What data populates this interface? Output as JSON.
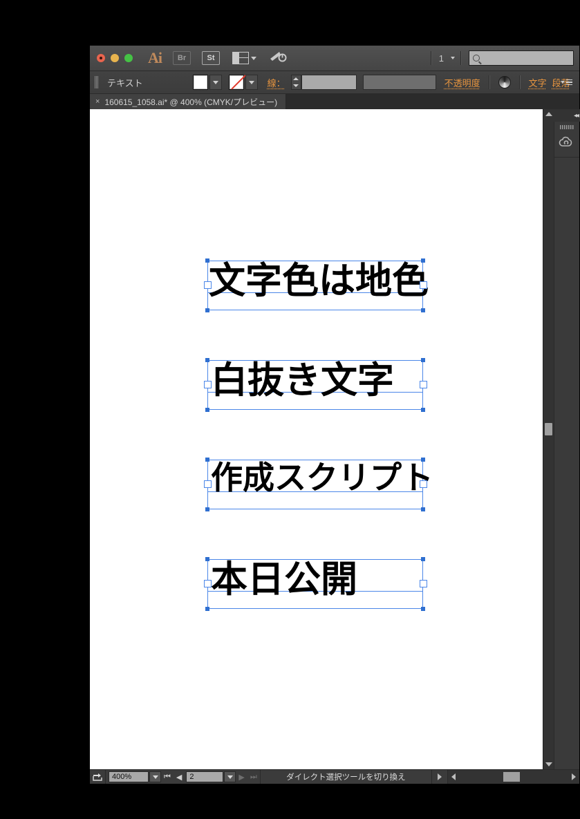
{
  "app": {
    "name": "Adobe Illustrator",
    "logo_text": "Ai"
  },
  "titlebar": {
    "bridge_label": "Br",
    "stock_label": "St",
    "arrange_name": "arrange-documents",
    "workspace_number": "1",
    "search_placeholder": ""
  },
  "controlbar": {
    "tool_name": "テキスト",
    "fill_color": "#000000",
    "stroke_value": "none",
    "stroke_label": "線：",
    "stroke_weight": "",
    "stroke_profile": "",
    "opacity_label": "不透明度",
    "character_label": "文字",
    "paragraph_label": "段落"
  },
  "tabbar": {
    "close_glyph": "×",
    "document_title": "160615_1058.ai* @ 400% (CMYK/プレビュー)"
  },
  "canvas": {
    "texts": [
      {
        "content": "文字色は地色"
      },
      {
        "content": "白抜き文字"
      },
      {
        "content": "作成スクリプト"
      },
      {
        "content": "本日公開"
      }
    ]
  },
  "statusbar": {
    "zoom": "400%",
    "page": "2",
    "message": "ダイレクト選択ツールを切り換え"
  },
  "colors": {
    "selection_blue": "#4a86e8",
    "accent_orange": "#e8953f",
    "panel_bg": "#3a3a3a",
    "canvas_bg": "#ffffff"
  }
}
